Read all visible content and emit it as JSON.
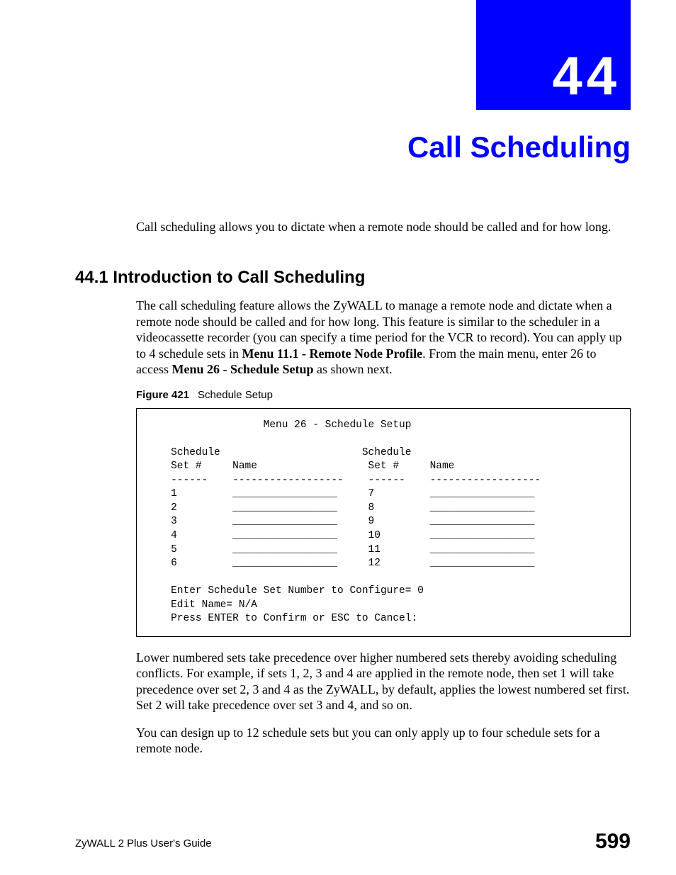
{
  "chapter": {
    "number": "44",
    "title": "Call Scheduling"
  },
  "intro": "Call scheduling allows you to dictate when a remote node should be called and for how long.",
  "section": {
    "heading": "44.1  Introduction to Call Scheduling",
    "para1_a": "The call scheduling feature allows the ZyWALL to manage a remote node and dictate when a remote node should be called and for how long. This feature is similar to the scheduler in a videocassette recorder (you can specify a time period for the VCR to record). You can apply up to 4 schedule sets in ",
    "para1_bold1": "Menu 11.1 - Remote Node Profile",
    "para1_b": ". From the main menu, enter 26 to access ",
    "para1_bold2": "Menu 26 - Schedule Setup",
    "para1_c": " as shown next.",
    "figure_label": "Figure 421",
    "figure_title": "Schedule Setup",
    "terminal": "                  Menu 26 - Schedule Setup\n\n   Schedule                       Schedule\n   Set #     Name                  Set #     Name\n   ------    ------------------    ------    ------------------\n   1         _________________     7         _________________\n   2         _________________     8         _________________\n   3         _________________     9         _________________\n   4         _________________     10        _________________\n   5         _________________     11        _________________\n   6         _________________     12        _________________\n\n   Enter Schedule Set Number to Configure= 0\n   Edit Name= N/A\n   Press ENTER to Confirm or ESC to Cancel:",
    "para2": "Lower numbered sets take precedence over higher numbered sets thereby avoiding scheduling conflicts. For example, if sets 1, 2, 3 and 4 are applied in the remote node, then set 1 will take precedence over set 2, 3 and 4 as the ZyWALL, by default, applies the lowest numbered set first. Set 2 will take precedence over set 3 and 4, and so on.",
    "para3": "You can design up to 12 schedule sets but you can only apply up to four schedule sets for a remote node."
  },
  "footer": {
    "left": "ZyWALL 2 Plus User's Guide",
    "page": "599"
  }
}
